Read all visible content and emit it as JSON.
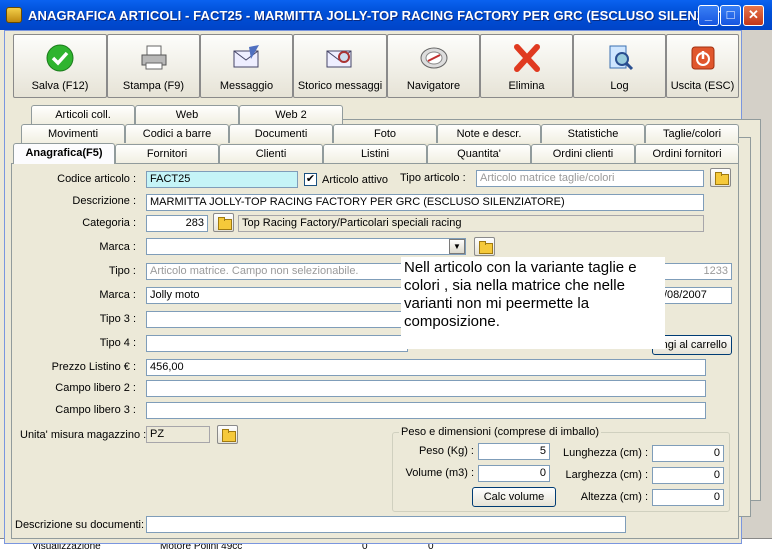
{
  "window": {
    "title": "ANAGRAFICA ARTICOLI - FACT25 - MARMITTA JOLLY-TOP RACING FACTORY PER GRC (ESCLUSO SILENZIAT...",
    "minimize": "_",
    "maximize": "□",
    "close": "✕"
  },
  "toolbar": {
    "save": "Salva (F12)",
    "print": "Stampa (F9)",
    "message": "Messaggio",
    "history": "Storico messaggi",
    "navigator": "Navigatore",
    "delete": "Elimina",
    "log": "Log",
    "exit": "Uscita (ESC)"
  },
  "tabs": {
    "row1": [
      "Articoli coll.",
      "Web",
      "Web 2"
    ],
    "row2": [
      "Movimenti",
      "Codici a barre",
      "Documenti",
      "Foto",
      "Note e descr.",
      "Statistiche",
      "Taglie/colori"
    ],
    "row3": [
      "Anagrafica(F5)",
      "Fornitori",
      "Clienti",
      "Listini",
      "Quantita'",
      "Ordini clienti",
      "Ordini fornitori"
    ]
  },
  "form": {
    "codice_label": "Codice articolo :",
    "codice_value": "FACT25",
    "attivo_label": "Articolo attivo",
    "attivo_checked": "✔",
    "tipo_articolo_label": "Tipo articolo :",
    "tipo_articolo_value": "Articolo matrice taglie/colori",
    "descrizione_label": "Descrizione :",
    "descrizione_value": "MARMITTA JOLLY-TOP RACING FACTORY PER GRC (ESCLUSO SILENZIATORE)",
    "categoria_label": "Categoria :",
    "categoria_code": "283",
    "categoria_desc": "Top Racing Factory/Particolari speciali racing",
    "marca1_label": "Marca :",
    "marca1_value": "",
    "tipo_label": "Tipo :",
    "tipo_value": "Articolo matrice. Campo non selezionabile.",
    "tipo_num": "1233",
    "marca2_label": "Marca :",
    "marca2_value": "Jolly moto",
    "date_value": "/08/2007",
    "tipo3_label": "Tipo 3 :",
    "tipo4_label": "Tipo 4 :",
    "carrello_button": "ngi al carrello",
    "prezzo_label": "Prezzo Listino € :",
    "prezzo_value": "456,00",
    "libero2_label": "Campo libero 2 :",
    "libero3_label": "Campo libero 3 :",
    "unita_label": "Unita' misura magazzino :",
    "unita_value": "PZ",
    "peso_group": "Peso e dimensioni (comprese di imballo)",
    "peso_label": "Peso (Kg) :",
    "peso_value": "5",
    "volume_label": "Volume (m3) :",
    "volume_value": "0",
    "lunghezza_label": "Lunghezza (cm) :",
    "lunghezza_value": "0",
    "larghezza_label": "Larghezza (cm) :",
    "larghezza_value": "0",
    "altezza_label": "Altezza (cm) :",
    "altezza_value": "0",
    "calc_volume": "Calc volume",
    "desc_doc_label": "Descrizione su documenti:",
    "desc_doc_value": ""
  },
  "annotation": {
    "text": "Nell articolo con la variante taglie e colori , sia nella matrice che nelle varianti non mi peermette la composizione."
  },
  "background": {
    "row_label": "Visualizzazione",
    "row_value": "Motore Polini 49cc",
    "row_n1": "0",
    "row_n2": "0"
  }
}
